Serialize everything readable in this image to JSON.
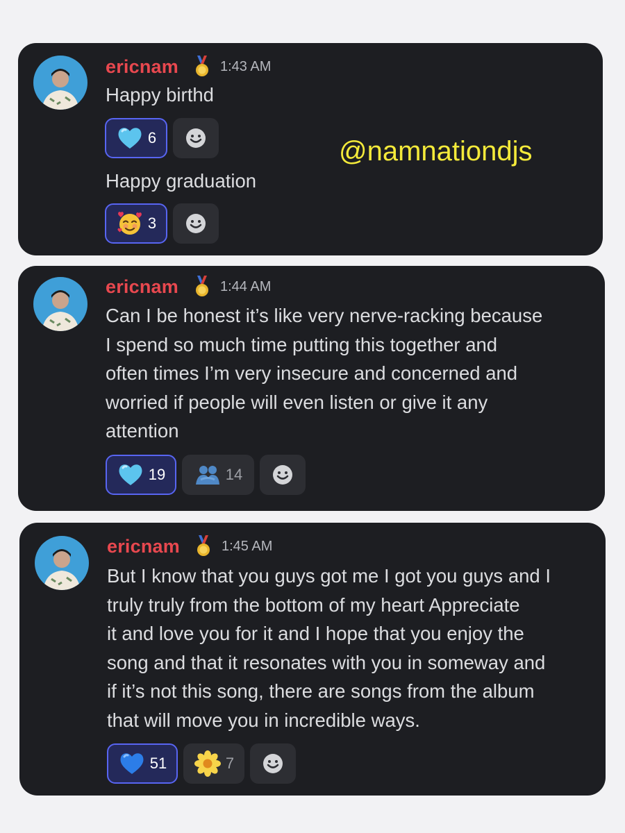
{
  "watermark": "@namnationdjs",
  "colors": {
    "card_bg": "#1d1e22",
    "username": "#e8484f",
    "text": "#dcdde0",
    "reaction_selected_border": "#5865f2",
    "watermark": "#f4ea3a"
  },
  "messages": [
    {
      "username": "ericnam",
      "badge_icon": "medal-icon",
      "time": "1:43 AM",
      "groups": [
        {
          "lines": [
            "Happy birthd"
          ],
          "reactions": [
            {
              "emoji": "light-blue-heart-icon",
              "count": "6",
              "selected": true
            }
          ]
        },
        {
          "lines": [
            "Happy graduation"
          ],
          "reactions": [
            {
              "emoji": "smiling-face-with-hearts-icon",
              "count": "3",
              "selected": true
            }
          ]
        }
      ]
    },
    {
      "username": "ericnam",
      "badge_icon": "medal-icon",
      "time": "1:44 AM",
      "groups": [
        {
          "lines": [
            "Can I be honest it’s like very nerve-racking because",
            "I spend so much time putting this together and",
            "often times I’m very insecure and concerned and",
            "worried if people will even listen or give it any",
            "attention"
          ],
          "reactions": [
            {
              "emoji": "light-blue-heart-icon",
              "count": "19",
              "selected": true
            },
            {
              "emoji": "people-hugging-icon",
              "count": "14",
              "selected": false
            }
          ]
        }
      ]
    },
    {
      "username": "ericnam",
      "badge_icon": "medal-icon",
      "time": "1:45 AM",
      "groups": [
        {
          "lines": [
            "But I know that you guys got me I got you guys and I",
            "truly truly from the bottom of my heart Appreciate",
            "it and love you for it and I hope that you enjoy the",
            "song and that it resonates with you in someway and",
            "if it’s not this song, there are songs from the album",
            "that will move you in incredible ways."
          ],
          "reactions": [
            {
              "emoji": "blue-heart-icon",
              "count": "51",
              "selected": true
            },
            {
              "emoji": "blossom-icon",
              "count": "7",
              "selected": false
            }
          ]
        }
      ]
    }
  ],
  "add_reaction_icon": "add-reaction-smiley-icon"
}
